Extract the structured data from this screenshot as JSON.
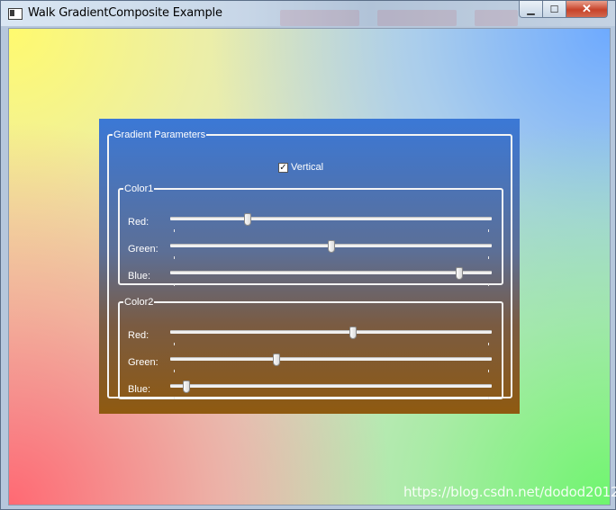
{
  "window": {
    "title": "Walk GradientComposite Example",
    "minimize_glyph": "▁",
    "maximize_glyph": "☐",
    "close_glyph": "✕"
  },
  "params": {
    "group_title": "Gradient Parameters",
    "vertical": {
      "label": "Vertical",
      "checked": true,
      "check_glyph": "✓"
    },
    "color1": {
      "title": "Color1",
      "sliders": [
        {
          "label": "Red:",
          "fraction": 0.24
        },
        {
          "label": "Green:",
          "fraction": 0.5
        },
        {
          "label": "Blue:",
          "fraction": 0.9
        }
      ]
    },
    "color2": {
      "title": "Color2",
      "sliders": [
        {
          "label": "Red:",
          "fraction": 0.57
        },
        {
          "label": "Green:",
          "fraction": 0.33
        },
        {
          "label": "Blue:",
          "fraction": 0.05
        }
      ]
    }
  },
  "watermark": "https://blog.csdn.net/dodod2012"
}
